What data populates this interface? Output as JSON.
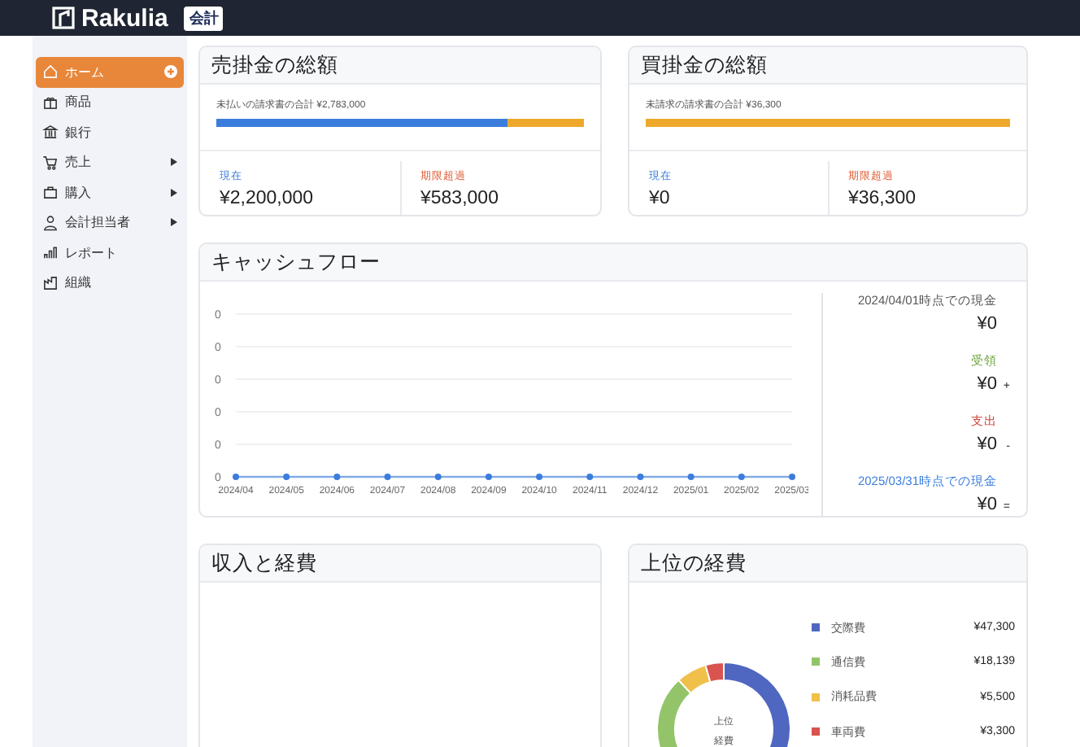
{
  "app": {
    "brand": "Rakulia",
    "badge": "会計"
  },
  "sidebar": {
    "items": [
      {
        "label": "ホーム",
        "selected": true,
        "expandable": false,
        "add_button": true
      },
      {
        "label": "商品",
        "selected": false,
        "expandable": false,
        "add_button": false
      },
      {
        "label": "銀行",
        "selected": false,
        "expandable": false,
        "add_button": false
      },
      {
        "label": "売上",
        "selected": false,
        "expandable": true,
        "add_button": false
      },
      {
        "label": "購入",
        "selected": false,
        "expandable": true,
        "add_button": false
      },
      {
        "label": "会計担当者",
        "selected": false,
        "expandable": true,
        "add_button": false
      },
      {
        "label": "レポート",
        "selected": false,
        "expandable": false,
        "add_button": false
      },
      {
        "label": "組織",
        "selected": false,
        "expandable": false,
        "add_button": false
      }
    ]
  },
  "receivables": {
    "title": "売掛金の総額",
    "caption": "未払いの請求書の合計 ¥2,783,000",
    "level": 0.79,
    "current_label": "現在",
    "current_amount": "¥2,200,000",
    "overdue_label": "期限超過",
    "overdue_amount": "¥583,000"
  },
  "payables": {
    "title": "買掛金の総額",
    "caption": "未請求の請求書の合計 ¥36,300",
    "level": 0,
    "current_label": "現在",
    "current_amount": "¥0",
    "overdue_label": "期限超過",
    "overdue_amount": "¥36,300"
  },
  "cash_flow": {
    "title": "キャッシュフロー",
    "chart": {
      "x_labels": [
        "2024/04",
        "2024/05",
        "2024/06",
        "2024/07",
        "2024/08",
        "2024/09",
        "2024/10",
        "2024/11",
        "2024/12",
        "2025/01",
        "2025/02",
        "2025/03"
      ],
      "y_labels": [
        "0",
        "0",
        "0",
        "0",
        "0",
        "0"
      ]
    },
    "summary": [
      {
        "kind": "opening",
        "label": "2024/04/01時点での現金",
        "amount": "¥0"
      },
      {
        "kind": "receipts",
        "label": "受領",
        "amount": "¥0",
        "sign": "+"
      },
      {
        "kind": "payments",
        "label": "支出",
        "amount": "¥0",
        "sign": "-"
      },
      {
        "kind": "closing",
        "label": "2025/03/31時点での現金",
        "amount": "¥0",
        "sign": "="
      }
    ]
  },
  "income_expenses": {
    "title": "収入と経費"
  },
  "top_expenses": {
    "title": "上位の経費",
    "center_lines": [
      "上位",
      "経費"
    ],
    "legend": [
      {
        "label": "交際費",
        "amount": "¥47,300",
        "color": "#4f67c0"
      },
      {
        "label": "通信費",
        "amount": "¥18,139",
        "color": "#93c46a"
      },
      {
        "label": "消耗品費",
        "amount": "¥5,500",
        "color": "#f0c04a"
      },
      {
        "label": "車両費",
        "amount": "¥3,300",
        "color": "#d9534f"
      }
    ]
  }
}
